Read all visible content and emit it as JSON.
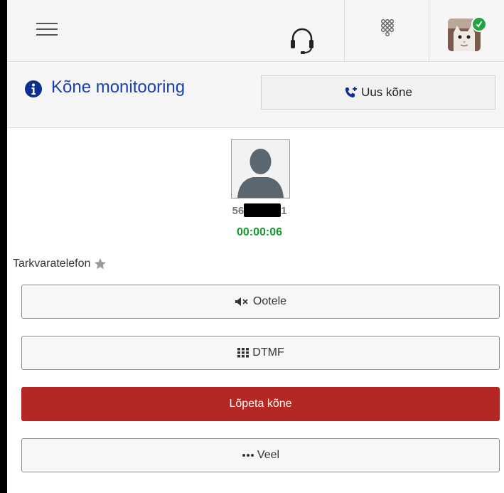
{
  "topbar": {
    "menu_icon": "hamburger-menu-icon",
    "headset_icon": "headset-icon",
    "dialpad_icon": "dialpad-icon",
    "avatar": "user-avatar-cat",
    "status": "online"
  },
  "header": {
    "title": "Kõne monitooring",
    "new_call_label": "Uus kõne",
    "info_icon": "info-circle-icon",
    "new_call_icon": "phone-plus-icon"
  },
  "call": {
    "number_prefix": "56",
    "number_suffix": "1",
    "timer": "00:00:06",
    "device_label": "Tarkvaratelefon"
  },
  "actions": {
    "hold_label": "Ootele",
    "dtmf_label": "DTMF",
    "end_label": "Lõpeta kõne",
    "more_label": "Veel"
  },
  "colors": {
    "title": "#1a3fb0",
    "timer": "#159a2e",
    "end_button": "#b52722",
    "status_online": "#22a344"
  }
}
